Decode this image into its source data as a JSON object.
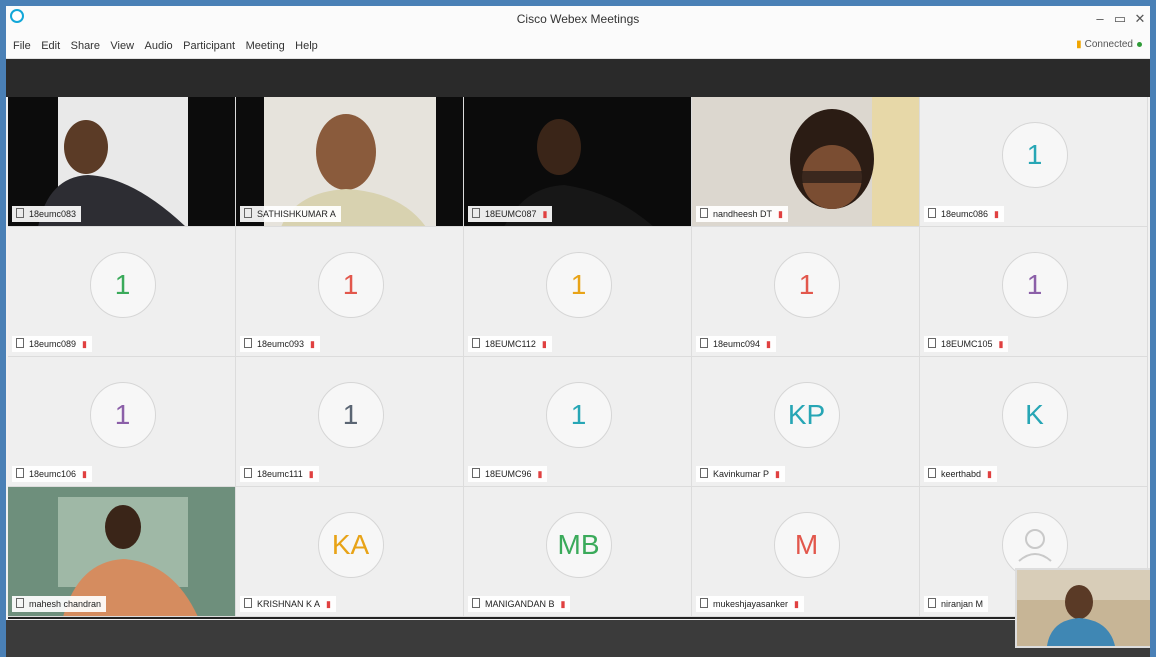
{
  "window": {
    "title": "Cisco Webex Meetings",
    "minimize": "–",
    "restore": "▭",
    "close": "✕"
  },
  "menu": [
    "File",
    "Edit",
    "Share",
    "View",
    "Audio",
    "Participant",
    "Meeting",
    "Help"
  ],
  "status": {
    "label": "Connected"
  },
  "participants": [
    {
      "name": "18eumc083",
      "type": "video",
      "muted": false
    },
    {
      "name": "SATHISHKUMAR A",
      "type": "video",
      "muted": false
    },
    {
      "name": "18EUMC087",
      "type": "video",
      "muted": true
    },
    {
      "name": "nandheesh DT",
      "type": "video",
      "muted": true
    },
    {
      "name": "18eumc086",
      "type": "avatar",
      "initials": "1",
      "color": "#27a6b5",
      "muted": true
    },
    {
      "name": "18eumc089",
      "type": "avatar",
      "initials": "1",
      "color": "#3aaa5a",
      "muted": true
    },
    {
      "name": "18eumc093",
      "type": "avatar",
      "initials": "1",
      "color": "#e2574c",
      "muted": true
    },
    {
      "name": "18EUMC112",
      "type": "avatar",
      "initials": "1",
      "color": "#e8a317",
      "muted": true
    },
    {
      "name": "18eumc094",
      "type": "avatar",
      "initials": "1",
      "color": "#e2574c",
      "muted": true
    },
    {
      "name": "18EUMC105",
      "type": "avatar",
      "initials": "1",
      "color": "#8b5fa8",
      "muted": true
    },
    {
      "name": "18eumc106",
      "type": "avatar",
      "initials": "1",
      "color": "#8b5fa8",
      "muted": true
    },
    {
      "name": "18eumc111",
      "type": "avatar",
      "initials": "1",
      "color": "#5a6573",
      "muted": true
    },
    {
      "name": "18EUMC96",
      "type": "avatar",
      "initials": "1",
      "color": "#27a6b5",
      "muted": true
    },
    {
      "name": "Kavinkumar P",
      "type": "avatar",
      "initials": "KP",
      "color": "#27a6b5",
      "muted": true
    },
    {
      "name": "keerthabd",
      "type": "avatar",
      "initials": "K",
      "color": "#27a6b5",
      "muted": true
    },
    {
      "name": "mahesh chandran",
      "type": "video",
      "muted": false
    },
    {
      "name": "KRISHNAN K A",
      "type": "avatar",
      "initials": "KA",
      "color": "#e8a317",
      "muted": true
    },
    {
      "name": "MANIGANDAN B",
      "type": "avatar",
      "initials": "MB",
      "color": "#3aaa5a",
      "muted": true
    },
    {
      "name": "mukeshjayasanker",
      "type": "avatar",
      "initials": "M",
      "color": "#e2574c",
      "muted": true
    },
    {
      "name": "niranjan M",
      "type": "avatar",
      "initials": "",
      "color": "#cccccc",
      "muted": false
    }
  ]
}
